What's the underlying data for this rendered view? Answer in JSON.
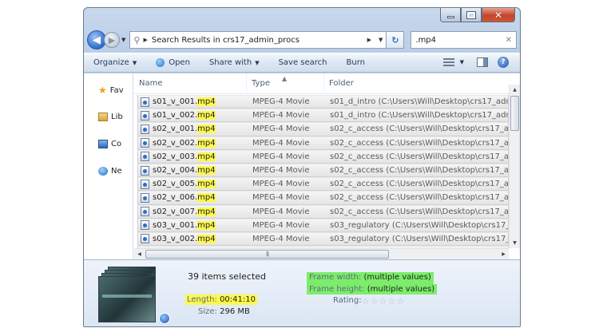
{
  "address": {
    "text": "Search Results in crs17_admin_procs"
  },
  "search": {
    "value": ".mp4"
  },
  "toolbar": {
    "organize": "Organize",
    "open": "Open",
    "share_with": "Share with",
    "save_search": "Save search",
    "burn": "Burn"
  },
  "navpane": {
    "items": [
      {
        "label": "Fav",
        "icon": "star-icon"
      },
      {
        "label": "Lib",
        "icon": "library-icon"
      },
      {
        "label": "Co",
        "icon": "computer-icon"
      },
      {
        "label": "Ne",
        "icon": "network-icon"
      }
    ]
  },
  "columns": {
    "name": "Name",
    "type": "Type",
    "folder": "Folder"
  },
  "files": [
    {
      "base": "s01_v_001.",
      "ext": "mp4",
      "type": "MPEG-4 Movie",
      "folder": "s01_d_intro (C:\\Users\\Will\\Desktop\\crs17_admin_pr"
    },
    {
      "base": "s01_v_002.",
      "ext": "mp4",
      "type": "MPEG-4 Movie",
      "folder": "s01_d_intro (C:\\Users\\Will\\Desktop\\crs17_admin_pr"
    },
    {
      "base": "s02_v_001.",
      "ext": "mp4",
      "type": "MPEG-4 Movie",
      "folder": "s02_c_access (C:\\Users\\Will\\Desktop\\crs17_admin_p"
    },
    {
      "base": "s02_v_002.",
      "ext": "mp4",
      "type": "MPEG-4 Movie",
      "folder": "s02_c_access (C:\\Users\\Will\\Desktop\\crs17_admin_p"
    },
    {
      "base": "s02_v_003.",
      "ext": "mp4",
      "type": "MPEG-4 Movie",
      "folder": "s02_c_access (C:\\Users\\Will\\Desktop\\crs17_admin_p"
    },
    {
      "base": "s02_v_004.",
      "ext": "mp4",
      "type": "MPEG-4 Movie",
      "folder": "s02_c_access (C:\\Users\\Will\\Desktop\\crs17_admin_p"
    },
    {
      "base": "s02_v_005.",
      "ext": "mp4",
      "type": "MPEG-4 Movie",
      "folder": "s02_c_access (C:\\Users\\Will\\Desktop\\crs17_admin_p"
    },
    {
      "base": "s02_v_006.",
      "ext": "mp4",
      "type": "MPEG-4 Movie",
      "folder": "s02_c_access (C:\\Users\\Will\\Desktop\\crs17_admin_p"
    },
    {
      "base": "s02_v_007.",
      "ext": "mp4",
      "type": "MPEG-4 Movie",
      "folder": "s02_c_access (C:\\Users\\Will\\Desktop\\crs17_admin_p"
    },
    {
      "base": "s03_v_001.",
      "ext": "mp4",
      "type": "MPEG-4 Movie",
      "folder": "s03_regulatory (C:\\Users\\Will\\Desktop\\crs17_admin"
    },
    {
      "base": "s03_v_002.",
      "ext": "mp4",
      "type": "MPEG-4 Movie",
      "folder": "s03_regulatory (C:\\Users\\Will\\Desktop\\crs17_admin"
    }
  ],
  "details": {
    "selection": "39 items selected",
    "length_label": "Length:",
    "length_value": "00:41:10",
    "size_label": "Size:",
    "size_value": "296 MB",
    "frame_width_label": "Frame width:",
    "frame_width_value": "(multiple values)",
    "frame_height_label": "Frame height:",
    "frame_height_value": "(multiple values)",
    "rating_label": "Rating:",
    "rating_stars": 0
  }
}
